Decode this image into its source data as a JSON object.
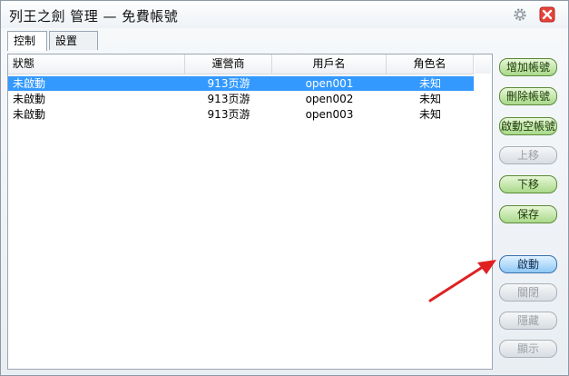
{
  "window": {
    "title": "列王之劍 管理 — 免費帳號",
    "icons": {
      "settings": "gear-icon",
      "close": "close-icon"
    }
  },
  "tabs": [
    {
      "label": "控制",
      "active": true
    },
    {
      "label": "設置",
      "active": false
    }
  ],
  "table": {
    "columns": [
      "狀態",
      "運營商",
      "用戶名",
      "角色名"
    ],
    "rows": [
      {
        "status": "未啟動",
        "operator": "913页游",
        "username": "open001",
        "role": "未知",
        "selected": true
      },
      {
        "status": "未啟動",
        "operator": "913页游",
        "username": "open002",
        "role": "未知",
        "selected": false
      },
      {
        "status": "未啟動",
        "operator": "913页游",
        "username": "open003",
        "role": "未知",
        "selected": false
      }
    ]
  },
  "buttons": {
    "add": {
      "label": "增加帳號",
      "enabled": true
    },
    "delete": {
      "label": "刪除帳號",
      "enabled": true
    },
    "start_empty": {
      "label": "啟動空帳號",
      "enabled": true
    },
    "move_up": {
      "label": "上移",
      "enabled": false
    },
    "move_down": {
      "label": "下移",
      "enabled": true
    },
    "save": {
      "label": "保存",
      "enabled": true
    },
    "start": {
      "label": "啟動",
      "enabled": true
    },
    "close": {
      "label": "關閉",
      "enabled": false
    },
    "hide": {
      "label": "隱藏",
      "enabled": false
    },
    "show": {
      "label": "顯示",
      "enabled": false
    }
  },
  "colors": {
    "selection": "#3399ff",
    "arrow": "#e02020"
  }
}
